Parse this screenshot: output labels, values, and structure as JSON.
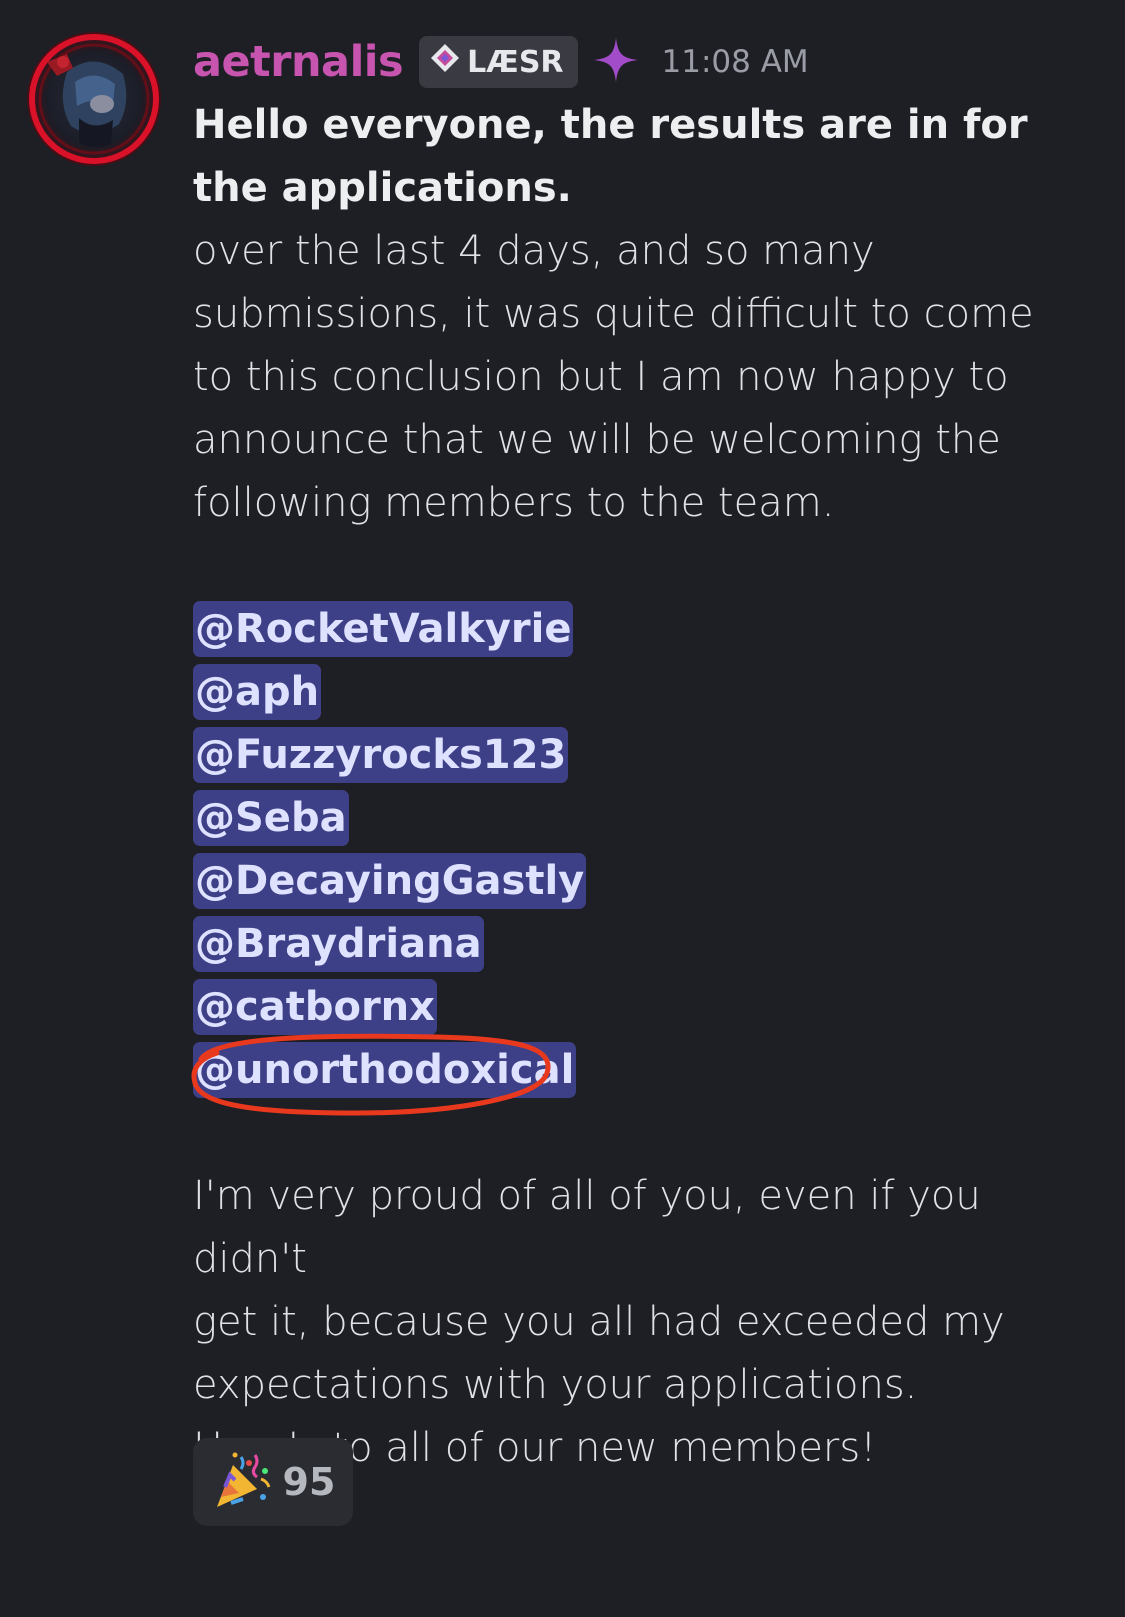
{
  "message": {
    "author": "aetrnalis",
    "role_tag": "LÆSR",
    "timestamp": "11:08 AM",
    "bold_line": "Hello everyone, the results are in for the applications.",
    "intro_lines": [
      "over the last 4 days, and so many",
      "submissions, it was quite difficult to come",
      "to this conclusion but I am now happy to",
      "announce that we will be welcoming the",
      "following members to the team."
    ],
    "mentions": [
      "@RocketValkyrie",
      "@aph",
      "@Fuzzyrocks123",
      "@Seba",
      "@DecayingGastly",
      "@Braydriana",
      "@catbornx",
      "@unorthodoxical"
    ],
    "outro_lines": [
      "I'm very proud of all of you, even if you didn't",
      "get it, because you all had exceeded my",
      "expectations with your applications.",
      "Here's to all of our new members!"
    ]
  },
  "reaction": {
    "emoji": "party-popper-icon",
    "count": "95"
  },
  "colors": {
    "background": "#1e1f24",
    "username": "#c755b0",
    "mention_bg": "#3d4087",
    "annotation": "#e8391f",
    "sparkle": "#a34cc9"
  }
}
